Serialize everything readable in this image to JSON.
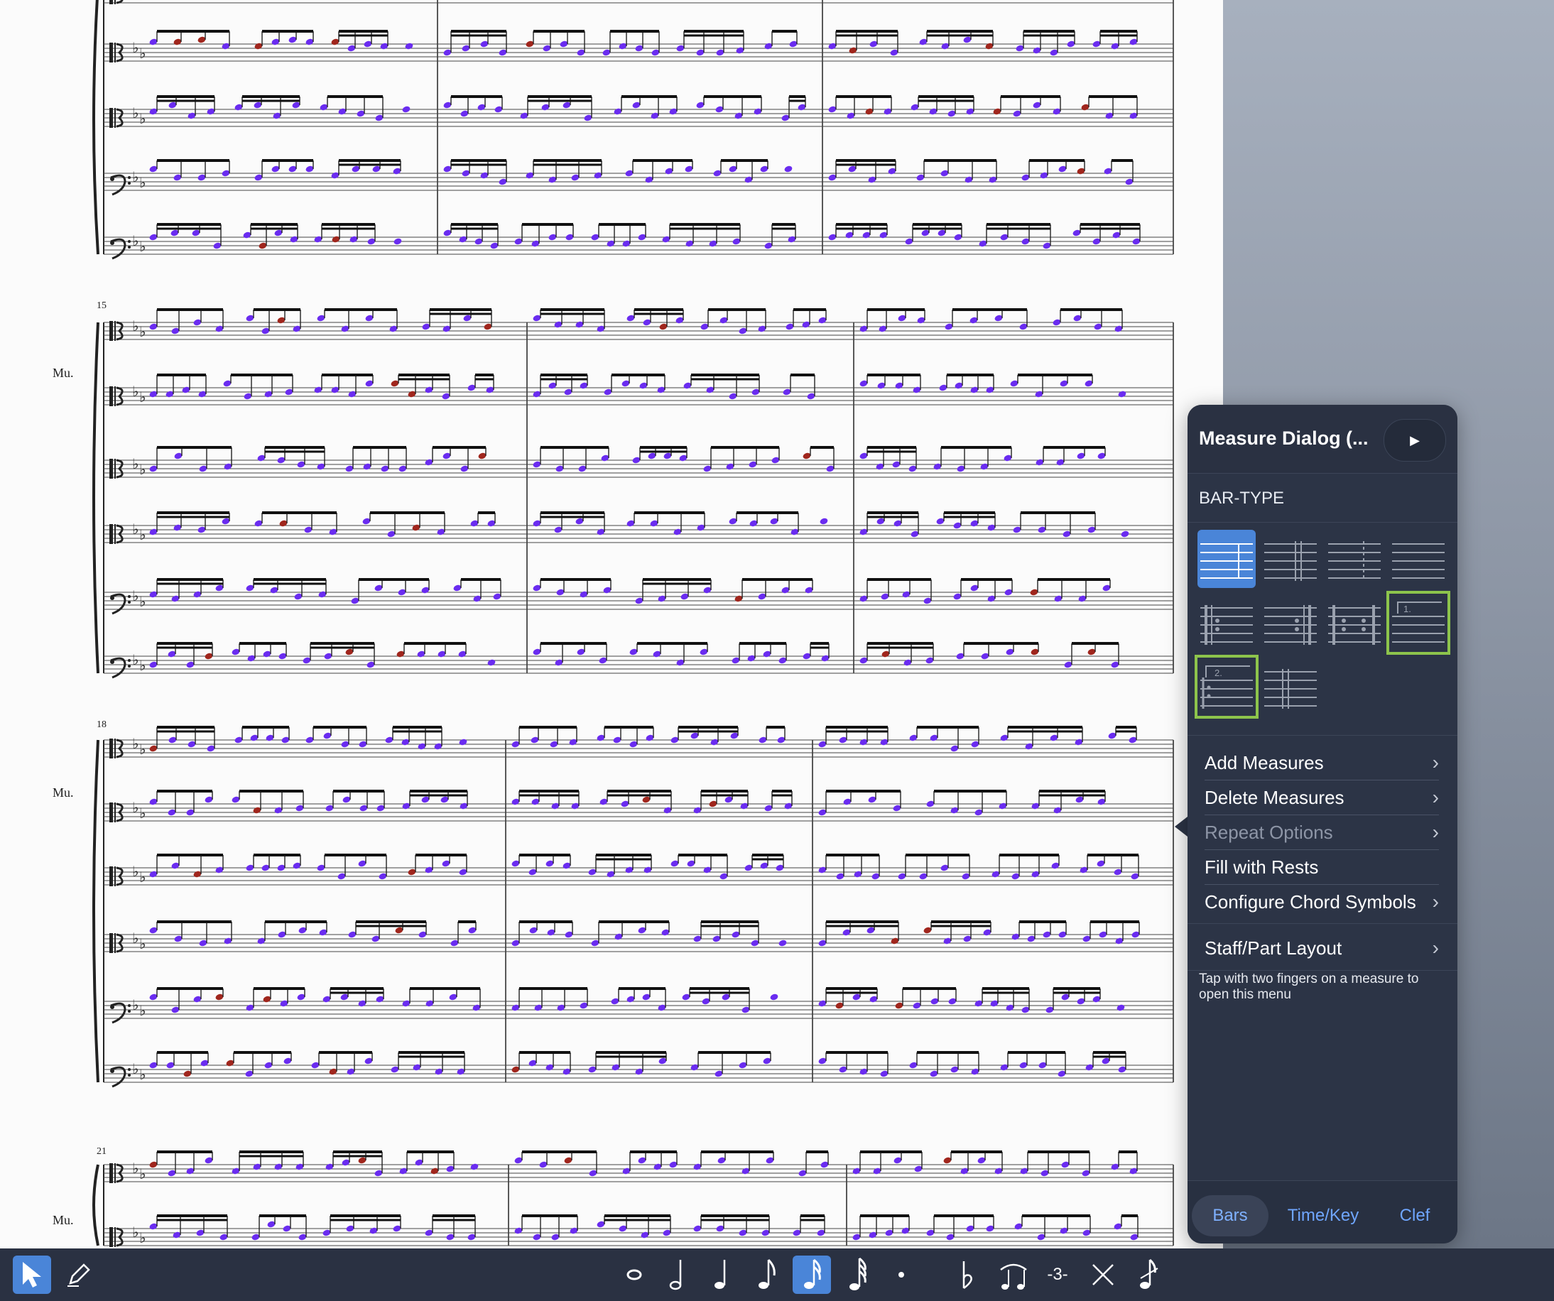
{
  "score": {
    "part_labels": [
      "Mu.",
      "Mu.",
      "Mu."
    ],
    "measure_numbers": [
      "15",
      "18",
      "21"
    ]
  },
  "measure_dialog": {
    "title": "Measure Dialog (...",
    "section": "BAR-TYPE",
    "bar_types": [
      "normal-barline",
      "double-barline",
      "dashed-barline",
      "no-barline",
      "repeat-start",
      "repeat-end",
      "repeat-both",
      "first-ending",
      "second-ending",
      "final-barline"
    ],
    "selected_bar_type": "normal-barline",
    "menu_items": [
      {
        "label": "Add Measures",
        "chevron": "›",
        "enabled": true
      },
      {
        "label": "Delete Measures",
        "chevron": "›",
        "enabled": true
      },
      {
        "label": "Repeat Options",
        "chevron": "›",
        "enabled": false
      },
      {
        "label": "Fill with Rests",
        "chevron": "",
        "enabled": true
      },
      {
        "label": "Configure Chord Symbols",
        "chevron": "›",
        "enabled": true
      }
    ],
    "layout_item": {
      "label": "Staff/Part Layout",
      "chevron": "›"
    },
    "hint": "Tap with two fingers on a measure to open this menu",
    "tabs": [
      {
        "label": "Bars",
        "active": true
      },
      {
        "label": "Time/Key",
        "active": false
      },
      {
        "label": "Clef",
        "active": false
      }
    ],
    "play_icon": "▶"
  },
  "toolbar": {
    "tools": [
      "select-arrow-icon",
      "pencil-icon"
    ],
    "notes": [
      "whole-note-icon",
      "half-note-icon",
      "quarter-note-icon",
      "eighth-note-icon",
      "sixteenth-note-icon",
      "thirty-second-note-icon",
      "dot-icon",
      "flat-icon",
      "tie-icon",
      "triplet-icon",
      "delete-x-icon",
      "grace-note-icon"
    ],
    "active_note": "sixteenth-note-icon",
    "triplet_label": "-3-"
  },
  "colors": {
    "note": "#6a2cf0",
    "note_alt": "#a0261d",
    "panel": "#2c3446",
    "accent": "#4a85d8",
    "highlight": "#8dc44c"
  }
}
